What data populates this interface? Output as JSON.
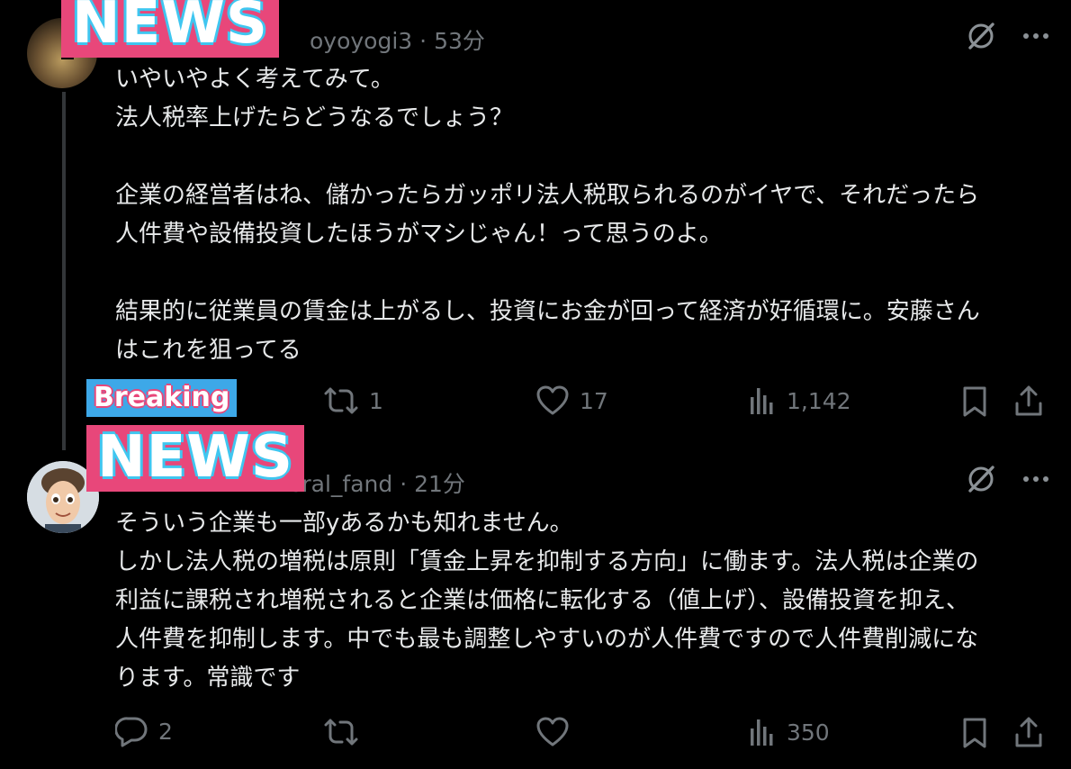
{
  "overlay": {
    "news_label": "NEWS",
    "breaking_label": "Breaking"
  },
  "posts": [
    {
      "handle_partial": "oyoyogi3",
      "time": "53分",
      "text": "いやいやよく考えてみて。\n法人税率上げたらどうなるでしょう？\n\n企業の経営者はね、儲かったらガッポリ法人税取られるのがイヤで、それだったら\n人件費や設備投資したほうがマシじゃん！って思うのよ。\n\n結果的に従業員の賃金は上がるし、投資にお金が回って経済が好循環に。安藤さん\nはこれを狙ってる",
      "reposts": "1",
      "likes": "17",
      "views": "1,142"
    },
    {
      "handle_partial": "eral_fand",
      "time": "21分",
      "text": "そういう企業も一部yあるかも知れません。\nしかし法人税の増税は原則「賃金上昇を抑制する方向」に働ます。法人税は企業の\n利益に課税され増税されると企業は価格に転化する（値上げ）、設備投資を抑え、\n人件費を抑制します。中でも最も調整しやすいのが人件費ですので人件費削減にな\nります。常識です",
      "replies": "2",
      "views": "350"
    }
  ],
  "separator": "·",
  "colors": {
    "background": "#000000",
    "text": "#e7e9ea",
    "muted": "#71767b",
    "news_pink": "#e8477a",
    "news_blue": "#3da8e8"
  }
}
